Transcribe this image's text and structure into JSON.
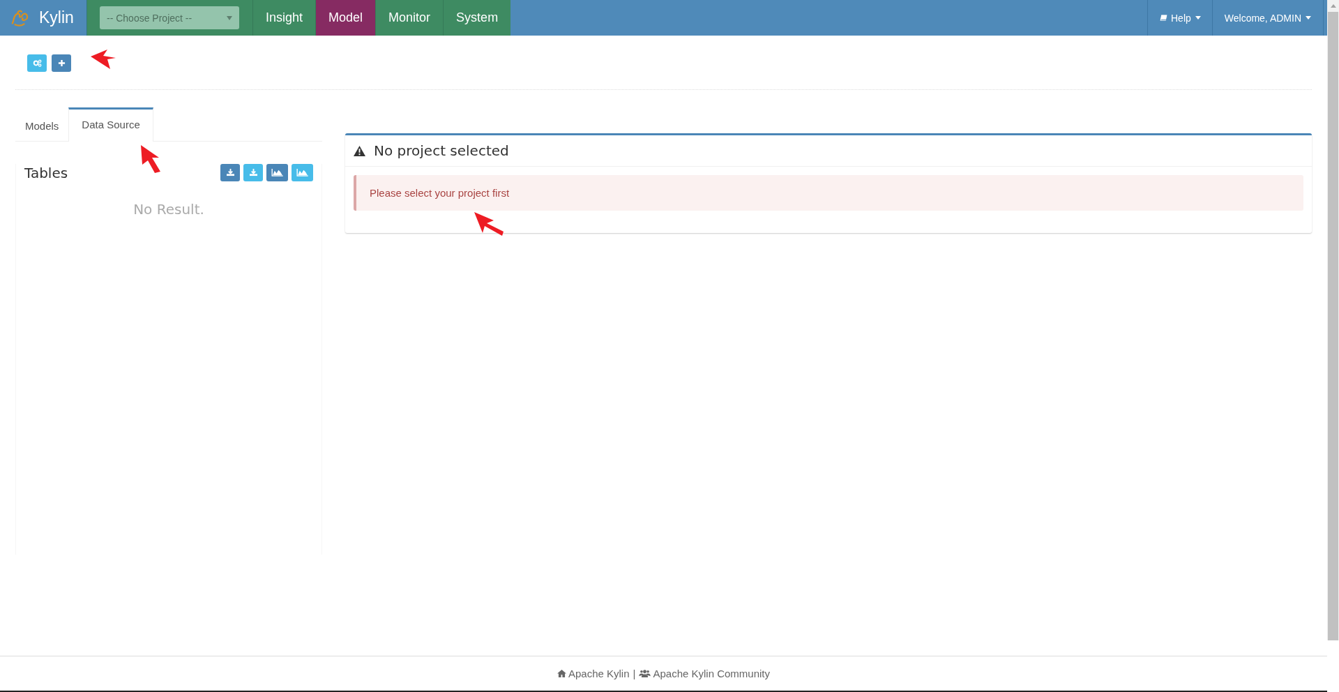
{
  "navbar": {
    "brand": "Kylin",
    "project_select": {
      "placeholder": "-- Choose Project --"
    },
    "items": [
      {
        "label": "Insight",
        "selected": false
      },
      {
        "label": "Model",
        "selected": true
      },
      {
        "label": "Monitor",
        "selected": false
      },
      {
        "label": "System",
        "selected": false
      }
    ],
    "help": "Help",
    "user": "Welcome, ADMIN"
  },
  "toolbar": [
    {
      "kind": "gears"
    },
    {
      "kind": "plus"
    }
  ],
  "tabs": [
    {
      "label": "Models",
      "selected": false
    },
    {
      "label": "Data Source",
      "selected": true
    }
  ],
  "tables_panel": {
    "title": "Tables",
    "buttons": [
      {
        "kind": "download"
      },
      {
        "kind": "download"
      },
      {
        "kind": "chart"
      },
      {
        "kind": "chart"
      }
    ],
    "empty": "No Result."
  },
  "notice": {
    "title": "No project selected",
    "message": "Please select your project first"
  },
  "footer": {
    "home_link": "Apache Kylin",
    "separator": "|",
    "community_link": "Apache Kylin Community"
  }
}
